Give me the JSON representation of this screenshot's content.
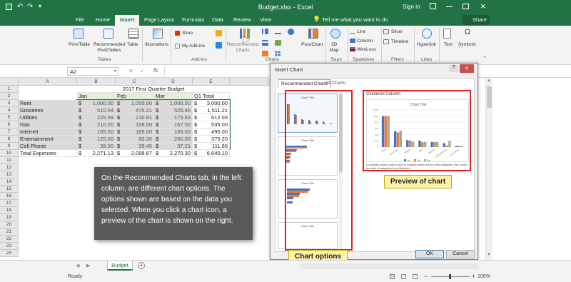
{
  "window": {
    "title": "Budget.xlsx - Excel",
    "signin": "Sign in"
  },
  "tabs": [
    "File",
    "Home",
    "Insert",
    "Page Layout",
    "Formulas",
    "Data",
    "Review",
    "View"
  ],
  "active_tab": "Insert",
  "tell_me": "Tell me what you want to do",
  "share": "Share",
  "ribbon": {
    "pivottable": "PivotTable",
    "rec_pivot1": "Recommended",
    "rec_pivot2": "PivotTables",
    "table": "Table",
    "illustrations": "Illustrations",
    "store": "Store",
    "addins": "My Add-ins",
    "rec_charts1": "Recommended",
    "rec_charts2": "Charts",
    "pivotchart": "PivotChart",
    "map1": "3D",
    "map2": "Map",
    "line": "Line",
    "column": "Column",
    "winloss": "Win/Loss",
    "slicer": "Slicer",
    "timeline": "Timeline",
    "hyperlink": "Hyperlink",
    "text": "Text",
    "symbols": "Symbols",
    "groups": {
      "tables": "Tables",
      "addins": "Add-ins",
      "charts": "Charts",
      "tours": "Tours",
      "sparklines": "Sparklines",
      "filters": "Filters",
      "links": "Links"
    }
  },
  "formula_bar": {
    "namebox": "A2",
    "fx": "fx"
  },
  "columns": [
    "A",
    "B",
    "C",
    "D",
    "E"
  ],
  "rows": [
    "1",
    "2",
    "3",
    "4",
    "5",
    "6",
    "7",
    "8",
    "9",
    "10",
    "11",
    "12",
    "13",
    "14",
    "15",
    "16",
    "17",
    "18",
    "19",
    "20",
    "21",
    "22",
    "23",
    "24"
  ],
  "sheet": {
    "title": "2017 First Quarter Budget",
    "months": [
      "Jan",
      "Feb",
      "Mar"
    ],
    "q1": "Q1 Total",
    "items": [
      {
        "name": "Rent",
        "jan": "1,000.00",
        "feb": "1,000.00",
        "mar": "1,000.00",
        "total": "3,000.00"
      },
      {
        "name": "Groceries",
        "jan": "510.54",
        "feb": "475.21",
        "mar": "525.46",
        "total": "1,511.21"
      },
      {
        "name": "Utilities",
        "jan": "225.59",
        "feb": "210.81",
        "mar": "175.63",
        "total": "612.03"
      },
      {
        "name": "Gas",
        "jan": "210.00",
        "feb": "158.00",
        "mar": "167.00",
        "total": "535.00"
      },
      {
        "name": "Internet",
        "jan": "165.00",
        "feb": "165.00",
        "mar": "165.00",
        "total": "495.00"
      },
      {
        "name": "Entertainment",
        "jan": "125.00",
        "feb": "50.20",
        "mar": "200.00",
        "total": "375.20"
      },
      {
        "name": "Cell Phone",
        "jan": "35.00",
        "feb": "39.45",
        "mar": "37.21",
        "total": "111.66"
      }
    ],
    "totals": {
      "name": "Total Expenses",
      "jan": "2,271.13",
      "feb": "2,098.67",
      "mar": "2,270.30",
      "total": "6,640.10"
    },
    "currency": "$"
  },
  "dialog": {
    "title": "Insert Chart",
    "help": "?",
    "close": "×",
    "tab1": "Recommended Charts",
    "tab2": "All Charts",
    "preview_title": "Clustered Column",
    "chart_title": "Chart Title",
    "option_title": "Chart Title",
    "description": "A clustered column chart is used to compare values across a few categories. Use it when the order of categories is not important.",
    "legend": [
      "Jan",
      "Feb",
      "Mar"
    ],
    "ok": "OK",
    "cancel": "Cancel"
  },
  "callouts": {
    "preview": "Preview of chart",
    "options": "Chart options"
  },
  "tooltip": "On the Recommended Charts tab, in the left column, are different chart options. The options shown are based on the data you selected. When you click a chart icon, a preview of the chart is shown on the right.",
  "sheet_tab": "Budget",
  "status": {
    "left": "Ready",
    "zoom": "100%"
  },
  "colors": {
    "excel_green": "#217346",
    "series1": "#4472c4",
    "series2": "#ed7d31",
    "series3": "#a5a5a5",
    "highlight": "#e02020",
    "callout": "#fff2a8"
  },
  "chart_data": {
    "type": "bar",
    "title": "Chart Title",
    "categories": [
      "Rent",
      "Groceries",
      "Utilities",
      "Gas",
      "Internet",
      "Entertainment",
      "Cell Phone"
    ],
    "series": [
      {
        "name": "Jan",
        "values": [
          1000,
          510.54,
          225.59,
          210,
          165,
          125,
          35
        ]
      },
      {
        "name": "Feb",
        "values": [
          1000,
          475.21,
          210.81,
          158,
          165,
          50.2,
          39.45
        ]
      },
      {
        "name": "Mar",
        "values": [
          1000,
          525.46,
          175.63,
          167,
          165,
          200,
          37.21
        ]
      }
    ],
    "ylim": [
      0,
      1200
    ]
  }
}
